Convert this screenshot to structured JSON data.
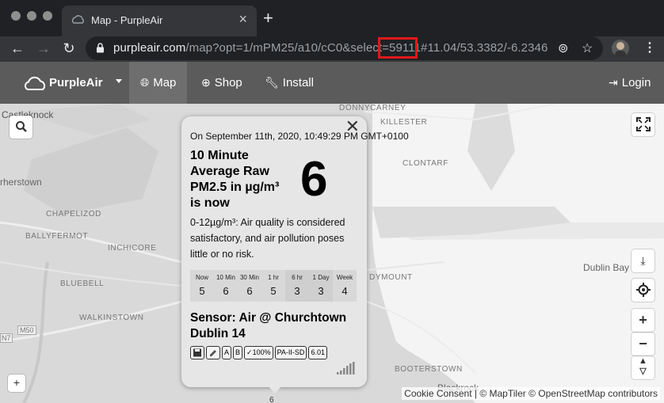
{
  "browser": {
    "tab_title": "Map - PurpleAir",
    "url_host": "purpleair.com",
    "url_path_before": "/map?opt=1/mPM25/a10/cC0&select=",
    "url_highlight": "59111",
    "url_path_after": "#11.04/53.3382/-6.2346",
    "highlight_color": "#e3171b"
  },
  "sitenav": {
    "brand": "PurpleAir",
    "items": [
      {
        "label": "Map",
        "icon": "globe-icon"
      },
      {
        "label": "Shop",
        "icon": "plus-circle-icon"
      },
      {
        "label": "Install",
        "icon": "wrench-icon"
      }
    ],
    "login": "Login",
    "bg_color": "#5b5b5b"
  },
  "map": {
    "labels": [
      "Castleknock",
      "DONNYCARNEY",
      "KILLESTER",
      "CLONTARF",
      "rherstown",
      "CHAPELIZOD",
      "BALLYFERMOT",
      "INCHICORE",
      "BLUEBELL",
      "WALKINSTOWN",
      "Dublin Bay",
      "DYMOUNT",
      "BOOTERSTOWN",
      "Blackrock",
      "M50",
      "N7",
      "6"
    ],
    "attribution": "Cookie Consent | © MapTiler © OpenStreetMap contributors"
  },
  "popup": {
    "date": "On September 11th, 2020, 10:49:29 PM GMT+0100",
    "metric": "10 Minute Average Raw PM2.5 in µg/m³ is now",
    "value": "6",
    "description": "0-12µg/m³: Air quality is considered satisfactory, and air pollution poses little or no risk.",
    "history": [
      {
        "label": "Now",
        "value": "5"
      },
      {
        "label": "10 Min",
        "value": "6"
      },
      {
        "label": "30 Min",
        "value": "6"
      },
      {
        "label": "1 hr",
        "value": "5"
      },
      {
        "label": "6 hr",
        "value": "3"
      },
      {
        "label": "1 Day",
        "value": "3"
      },
      {
        "label": "Week",
        "value": "4"
      }
    ],
    "sensor": "Sensor: Air @ Churchtown Dublin 14",
    "badges": [
      "A",
      "B",
      "✓100%",
      "PA-II-SD",
      "6.01"
    ]
  }
}
